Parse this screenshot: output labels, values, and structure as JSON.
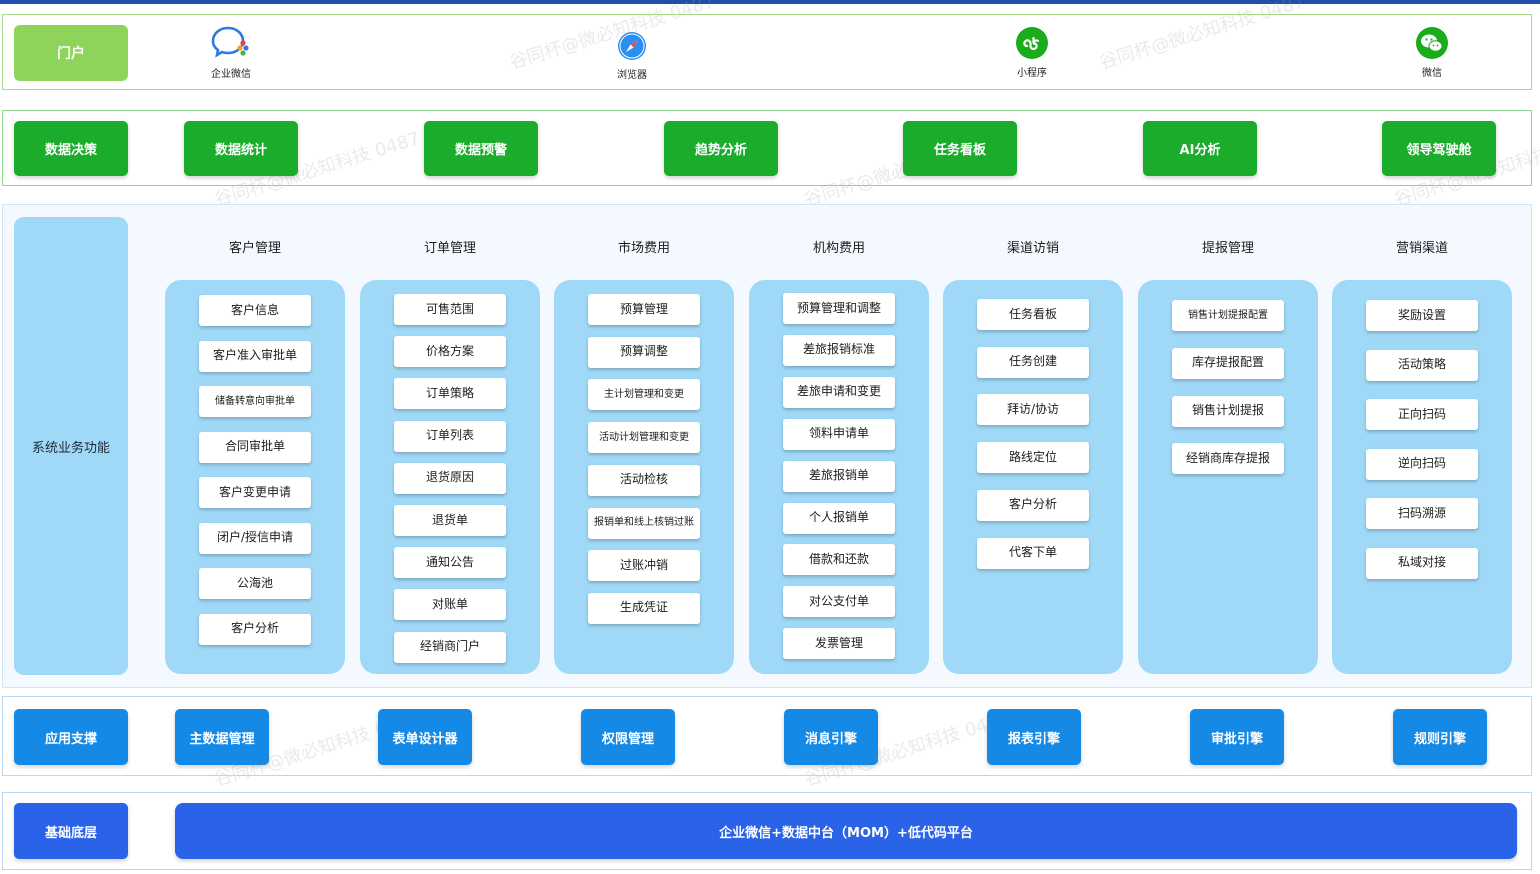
{
  "portal": {
    "label": "门户",
    "entries": [
      {
        "label": "企业微信",
        "icon": "wecom-icon"
      },
      {
        "label": "浏览器",
        "icon": "compass-icon"
      },
      {
        "label": "小程序",
        "icon": "mini-program-icon"
      },
      {
        "label": "微信",
        "icon": "wechat-icon"
      }
    ]
  },
  "analysis": [
    "数据决策",
    "数据统计",
    "数据预警",
    "趋势分析",
    "任务看板",
    "AI分析",
    "领导驾驶舱"
  ],
  "business": {
    "label": "系统业务功能",
    "columns": [
      {
        "title": "客户管理",
        "items": [
          "客户信息",
          "客户准入审批单",
          "储备转意向审批单",
          "合同审批单",
          "客户变更申请",
          "闭户/授信申请",
          "公海池",
          "客户分析"
        ]
      },
      {
        "title": "订单管理",
        "items": [
          "可售范围",
          "价格方案",
          "订单策略",
          "订单列表",
          "退货原因",
          "退货单",
          "通知公告",
          "对账单",
          "经销商门户"
        ]
      },
      {
        "title": "市场费用",
        "items": [
          "预算管理",
          "预算调整",
          "主计划管理和变更",
          "活动计划管理和变更",
          "活动检核",
          "报销单和线上核销过账",
          "过账冲销",
          "生成凭证"
        ]
      },
      {
        "title": "机构费用",
        "items": [
          "预算管理和调整",
          "差旅报销标准",
          "差旅申请和变更",
          "领料申请单",
          "差旅报销单",
          "个人报销单",
          "借款和还款",
          "对公支付单",
          "发票管理"
        ]
      },
      {
        "title": "渠道访销",
        "items": [
          "任务看板",
          "任务创建",
          "拜访/协访",
          "路线定位",
          "客户分析",
          "代客下单"
        ]
      },
      {
        "title": "提报管理",
        "items": [
          "销售计划提报配置",
          "库存提报配置",
          "销售计划提报",
          "经销商库存提报"
        ]
      },
      {
        "title": "营销渠道",
        "items": [
          "奖励设置",
          "活动策略",
          "正向扫码",
          "逆向扫码",
          "扫码溯源",
          "私域对接"
        ]
      }
    ]
  },
  "support": {
    "label": "应用支撑",
    "items": [
      "主数据管理",
      "表单设计器",
      "权限管理",
      "消息引擎",
      "报表引擎",
      "审批引擎",
      "规则引擎"
    ]
  },
  "base": {
    "label": "基础底层",
    "platform": "企业微信+数据中台（MOM）+低代码平台"
  },
  "watermark": "谷同杯@微必知科技 0487",
  "colors": {
    "green": "#1aac2a",
    "light_green": "#8ed45a",
    "blue": "#1589e6",
    "deep_blue": "#2a63e8",
    "panel": "#9fd9f7"
  }
}
